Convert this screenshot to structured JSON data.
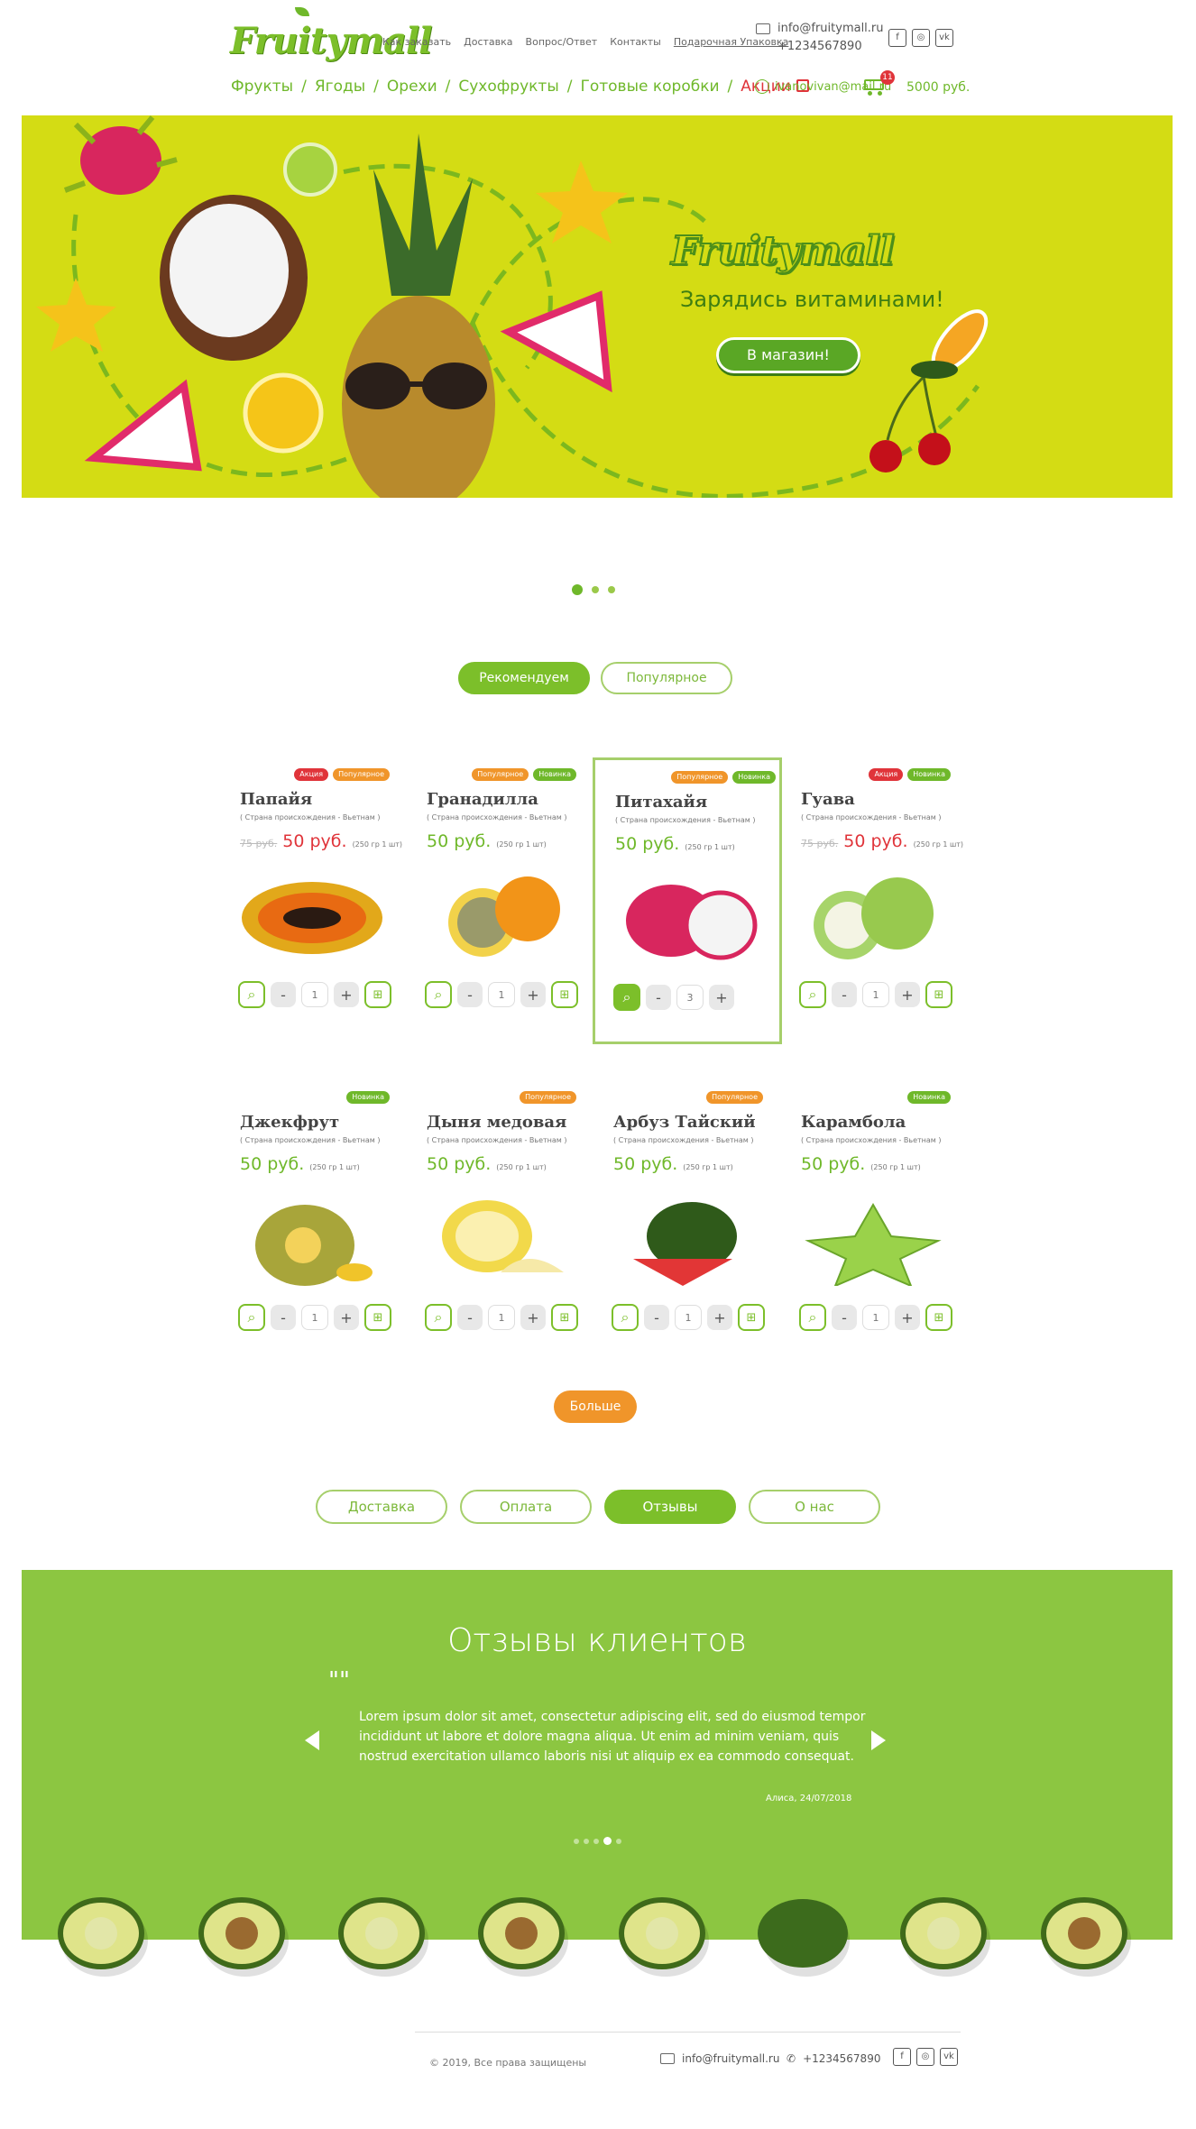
{
  "header": {
    "logo": "Fruitymall",
    "top_links": [
      "Как заказать",
      "Доставка",
      "Вопрос/Ответ",
      "Контакты",
      "Подарочная Упаковка"
    ],
    "email": "info@fruitymall.ru",
    "phone": "+1234567890",
    "social_icons": [
      "facebook-icon",
      "instagram-icon",
      "vk-icon"
    ],
    "categories": [
      "Фрукты",
      "Ягоды",
      "Орехи",
      "Сухофрукты",
      "Готовые коробки"
    ],
    "sale_label": "Акции",
    "user_email": "ivanovivan@mail.ru",
    "cart_count": "11",
    "cart_total": "5000 руб."
  },
  "hero": {
    "logo": "Fruitymall",
    "tagline": "Зарядись витаминами!",
    "button": "В магазин!"
  },
  "product_tabs": [
    "Рекомендуем",
    "Популярное"
  ],
  "products": [
    {
      "name": "Папайя",
      "origin": "( Страна происхождения  - Вьетнам )",
      "old_price": "75 руб.",
      "price": "50 руб.",
      "per": "(250 гр 1 шт)",
      "tags": [
        {
          "t": "Акция",
          "c": "red"
        },
        {
          "t": "Популярное",
          "c": "or"
        }
      ],
      "qty": "1",
      "sale": true
    },
    {
      "name": "Гранадилла",
      "origin": "( Страна происхождения  - Вьетнам )",
      "old_price": "",
      "price": "50 руб.",
      "per": "(250 гр 1 шт)",
      "tags": [
        {
          "t": "Популярное",
          "c": "or"
        },
        {
          "t": "Новинка",
          "c": "gr"
        }
      ],
      "qty": "1",
      "sale": false
    },
    {
      "name": "Питахайя",
      "origin": "( Страна происхождения  - Вьетнам )",
      "old_price": "",
      "price": "50 руб.",
      "per": "(250 гр 1 шт)",
      "tags": [
        {
          "t": "Популярное",
          "c": "or"
        },
        {
          "t": "Новинка",
          "c": "gr"
        }
      ],
      "qty": "3",
      "sale": false
    },
    {
      "name": "Гуава",
      "origin": "( Страна происхождения  - Вьетнам )",
      "old_price": "75 руб.",
      "price": "50 руб.",
      "per": "(250 гр 1 шт)",
      "tags": [
        {
          "t": "Акция",
          "c": "red"
        },
        {
          "t": "Новинка",
          "c": "gr"
        }
      ],
      "qty": "1",
      "sale": true
    },
    {
      "name": "Джекфрут",
      "origin": "( Страна происхождения  - Вьетнам )",
      "old_price": "",
      "price": "50 руб.",
      "per": "(250 гр 1 шт)",
      "tags": [
        {
          "t": "Новинка",
          "c": "gr"
        }
      ],
      "qty": "1",
      "sale": false
    },
    {
      "name": "Дыня медовая",
      "origin": "( Страна происхождения  - Вьетнам )",
      "old_price": "",
      "price": "50 руб.",
      "per": "(250 гр 1 шт)",
      "tags": [
        {
          "t": "Популярное",
          "c": "or"
        }
      ],
      "qty": "1",
      "sale": false
    },
    {
      "name": "Арбуз Тайский",
      "origin": "( Страна происхождения  - Вьетнам )",
      "old_price": "",
      "price": "50 руб.",
      "per": "(250 гр 1 шт)",
      "tags": [
        {
          "t": "Популярное",
          "c": "or"
        }
      ],
      "qty": "1",
      "sale": false
    },
    {
      "name": "Карамбола",
      "origin": "( Страна происхождения  - Вьетнам )",
      "old_price": "",
      "price": "50 руб.",
      "per": "(250 гр 1 шт)",
      "tags": [
        {
          "t": "Новинка",
          "c": "gr"
        }
      ],
      "qty": "1",
      "sale": false
    }
  ],
  "more_button": "Больше",
  "info_tabs": [
    "Доставка",
    "Оплата",
    "Отзывы",
    "О нас"
  ],
  "reviews": {
    "title": "Отзывы клиентов",
    "quote_mark": "\"\"",
    "text": "Lorem ipsum dolor sit amet, consectetur adipiscing elit, sed do eiusmod tempor incididunt ut labore et dolore magna aliqua. Ut enim ad minim veniam, quis nostrud exercitation ullamco laboris nisi ut aliquip ex ea commodo consequat.",
    "signature": "Алиса, 24/07/2018"
  },
  "footer": {
    "copyright": "© 2019, Все права защищены",
    "email": "info@fruitymall.ru",
    "phone": "+1234567890"
  },
  "colors": {
    "green": "#7cbf2a",
    "lime": "#d4dc14",
    "orange": "#f0952a",
    "red": "#e0343a",
    "review_bg": "#8cc641"
  }
}
